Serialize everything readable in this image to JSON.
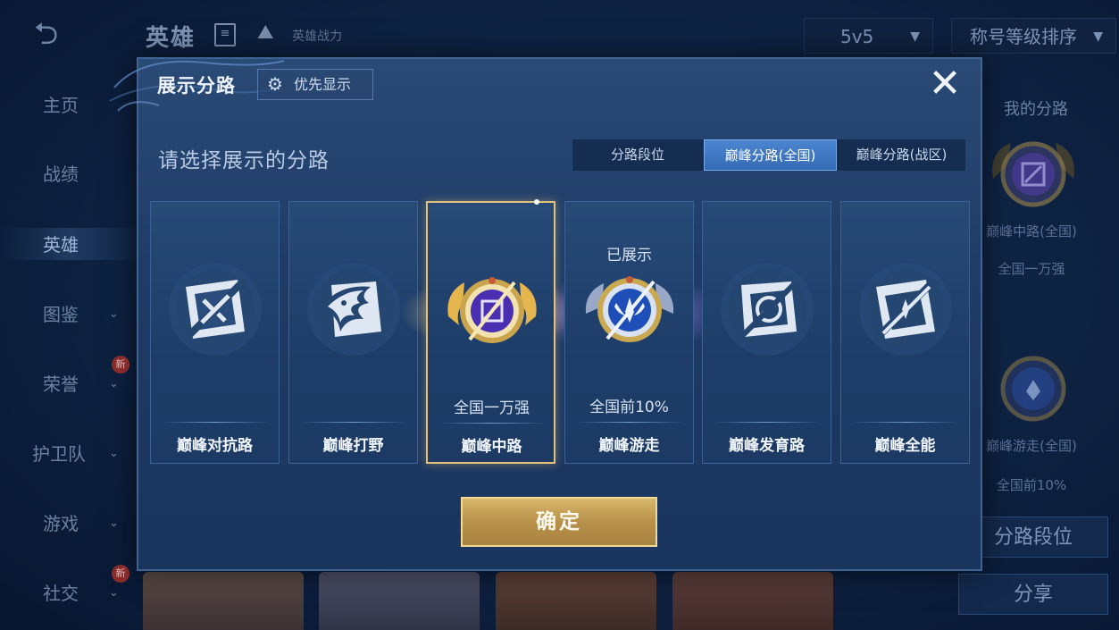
{
  "background": {
    "back_icon": "⮌",
    "title": "英雄",
    "power_label": "英雄战力",
    "mode_select": "5v5",
    "sort_select": "称号等级排序",
    "sidebar": [
      {
        "label": "主页",
        "chevron": false,
        "new": false
      },
      {
        "label": "战绩",
        "chevron": false,
        "new": false
      },
      {
        "label": "英雄",
        "chevron": false,
        "new": false,
        "active": true
      },
      {
        "label": "图鉴",
        "chevron": true,
        "new": false
      },
      {
        "label": "荣誉",
        "chevron": true,
        "new": true
      },
      {
        "label": "护卫队",
        "chevron": true,
        "new": false
      },
      {
        "label": "游戏",
        "chevron": true,
        "new": false
      },
      {
        "label": "社交",
        "chevron": true,
        "new": true
      }
    ],
    "new_badge": "新",
    "right_panel": {
      "label": "我的分路",
      "lane1": "巅峰中路(全国)",
      "lane1_rank": "全国一万强",
      "lane2": "巅峰游走(全国)",
      "lane2_rank": "全国前10%",
      "btn_lane_rank": "分路段位",
      "btn_share": "分享"
    }
  },
  "modal": {
    "title": "展示分路",
    "priority_button": "优先显示",
    "close_icon": "✕",
    "subtitle": "请选择展示的分路",
    "tabs": [
      {
        "label": "分路段位",
        "active": false
      },
      {
        "label": "巅峰分路(全国)",
        "active": true
      },
      {
        "label": "巅峰分路(战区)",
        "active": false
      }
    ],
    "cards": [
      {
        "lane": "巅峰对抗路",
        "icon": "clash-lane-icon",
        "rank": "",
        "shown": "",
        "selected": false
      },
      {
        "lane": "巅峰打野",
        "icon": "jungle-dragon-icon",
        "rank": "",
        "shown": "",
        "selected": false
      },
      {
        "lane": "巅峰中路",
        "icon": "mid-lane-gold-badge-icon",
        "rank": "全国一万强",
        "shown": "",
        "selected": true
      },
      {
        "lane": "巅峰游走",
        "icon": "roam-wings-badge-icon",
        "rank": "全国前10%",
        "shown": "已展示",
        "selected": false
      },
      {
        "lane": "巅峰发育路",
        "icon": "farm-lane-icon",
        "rank": "",
        "shown": "",
        "selected": false
      },
      {
        "lane": "巅峰全能",
        "icon": "all-round-icon",
        "rank": "",
        "shown": "",
        "selected": false
      }
    ],
    "confirm_button": "确定"
  },
  "colors": {
    "gold_accent": "#e2c27a",
    "tab_active": "#4c86d0",
    "modal_bg": "#234272"
  }
}
